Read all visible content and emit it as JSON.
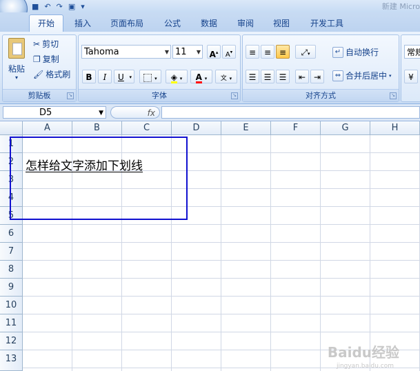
{
  "window": {
    "title": "新建 Micro"
  },
  "quick_access": {
    "undo": "↶",
    "redo": "↷"
  },
  "tabs": [
    {
      "label": "开始",
      "active": true
    },
    {
      "label": "插入"
    },
    {
      "label": "页面布局"
    },
    {
      "label": "公式"
    },
    {
      "label": "数据"
    },
    {
      "label": "审阅"
    },
    {
      "label": "视图"
    },
    {
      "label": "开发工具"
    }
  ],
  "clipboard": {
    "paste": "粘贴",
    "cut": "剪切",
    "copy": "复制",
    "format_painter": "格式刷",
    "group_label": "剪贴板"
  },
  "font": {
    "name": "Tahoma",
    "size": "11",
    "bold": "B",
    "italic": "I",
    "underline": "U",
    "group_label": "字体",
    "color_red": "#ff0000",
    "highlight_yellow": "#ffff00"
  },
  "alignment": {
    "wrap_text": "自动换行",
    "merge_center": "合并后居中",
    "group_label": "对齐方式"
  },
  "number": {
    "format": "常规"
  },
  "formula_bar": {
    "name_box": "D5",
    "fx": "fx",
    "value": ""
  },
  "sheet": {
    "columns": [
      "A",
      "B",
      "C",
      "D",
      "E",
      "F",
      "G",
      "H"
    ],
    "rows": [
      "1",
      "2",
      "3",
      "4",
      "5",
      "6",
      "7",
      "8",
      "9",
      "10",
      "11",
      "12",
      "13"
    ],
    "cell_a2": "怎样给文字添加下划线"
  },
  "watermark": {
    "text": "Baidu经验",
    "sub": "jingyan.baidu.com"
  },
  "colors": {
    "highlight_box": "#1010d0",
    "ribbon_bg": "#dbe8f8"
  }
}
